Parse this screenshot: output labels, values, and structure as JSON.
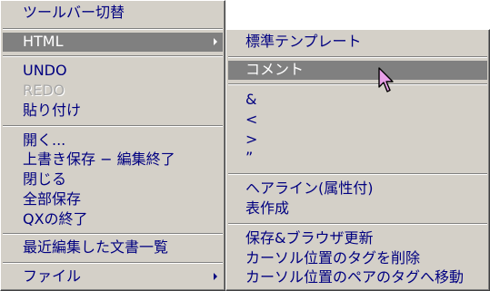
{
  "main_menu": {
    "items": [
      {
        "label": "ツールバー切替"
      },
      {
        "label": "HTML"
      },
      {
        "label": "UNDO"
      },
      {
        "label": "REDO"
      },
      {
        "label": "貼り付け"
      },
      {
        "label": "開く..."
      },
      {
        "label": "上書き保存 − 編集終了"
      },
      {
        "label": "閉じる"
      },
      {
        "label": "全部保存"
      },
      {
        "label": "QXの終了"
      },
      {
        "label": "最近編集した文書一覧"
      },
      {
        "label": "ファイル"
      }
    ]
  },
  "sub_menu": {
    "items": [
      {
        "label": "標準テンプレート"
      },
      {
        "label": "コメント"
      },
      {
        "label": "&"
      },
      {
        "label": "<"
      },
      {
        "label": ">"
      },
      {
        "label": "”"
      },
      {
        "label": "ヘアライン(属性付)"
      },
      {
        "label": "表作成"
      },
      {
        "label": "保存&ブラウザ更新"
      },
      {
        "label": "カーソル位置のタグを削除"
      },
      {
        "label": "カーソル位置のペアのタグへ移動"
      }
    ]
  },
  "colors": {
    "menu_bg": "#d4d0c8",
    "text": "#000080",
    "highlight_bg": "#808080",
    "disabled_text": "#a8a8a8"
  },
  "icons": {
    "pointer": "mouse-pointer-icon"
  }
}
